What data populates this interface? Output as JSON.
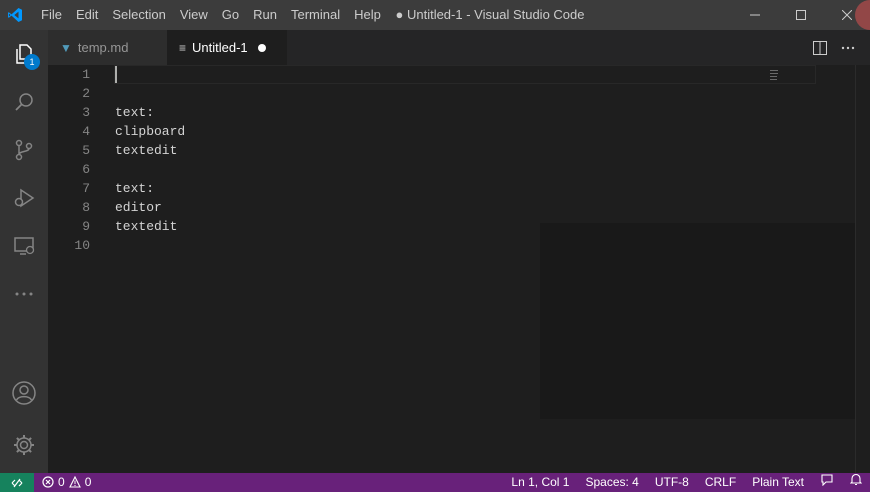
{
  "titlebar": {
    "menu": [
      "File",
      "Edit",
      "Selection",
      "View",
      "Go",
      "Run",
      "Terminal",
      "Help"
    ],
    "title": "● Untitled-1 - Visual Studio Code"
  },
  "activity_bar": {
    "explorer_badge": "1",
    "icons": [
      "files-icon",
      "search-icon",
      "source-control-icon",
      "run-debug-icon",
      "remote-explorer-icon",
      "more-icon",
      "account-icon",
      "settings-gear-icon"
    ]
  },
  "tabs": [
    {
      "label": "temp.md",
      "icon": "markdown-icon",
      "active": false
    },
    {
      "label": "Untitled-1",
      "icon": "text-file-icon",
      "active": true,
      "dirty": true
    }
  ],
  "editor": {
    "lines": [
      {
        "n": "1",
        "text": ""
      },
      {
        "n": "2",
        "text": ""
      },
      {
        "n": "3",
        "text": "text:"
      },
      {
        "n": "4",
        "text": "clipboard"
      },
      {
        "n": "5",
        "text": "textedit"
      },
      {
        "n": "6",
        "text": ""
      },
      {
        "n": "7",
        "text": "text:"
      },
      {
        "n": "8",
        "text": "editor"
      },
      {
        "n": "9",
        "text": "textedit"
      },
      {
        "n": "10",
        "text": ""
      }
    ]
  },
  "statusbar": {
    "errors": "0",
    "warnings": "0",
    "position": "Ln 1, Col 1",
    "spaces": "Spaces: 4",
    "encoding": "UTF-8",
    "eol": "CRLF",
    "language": "Plain Text"
  },
  "colors": {
    "statusbar": "#68217a",
    "remote": "#16825d",
    "accent": "#007acc"
  }
}
